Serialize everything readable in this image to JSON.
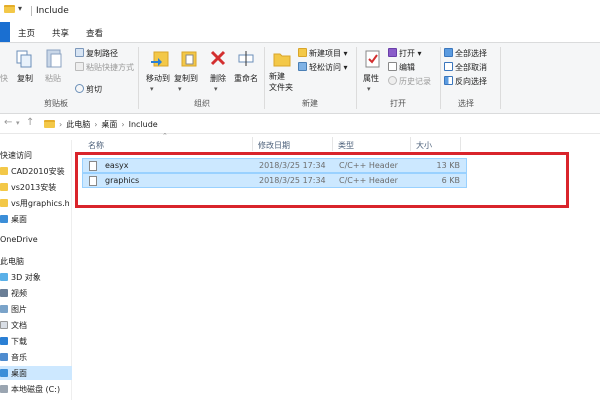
{
  "window": {
    "title": "Include"
  },
  "ribbon_tabs": [
    "主页",
    "共享",
    "查看"
  ],
  "ribbon": {
    "clipboard": {
      "pin_label": "快",
      "copy_label": "复制",
      "paste_label": "粘贴",
      "copy_path_label": "复制路径",
      "paste_shortcut_label": "粘贴快捷方式",
      "cut_label": "剪切",
      "group_label": "剪贴板"
    },
    "organize": {
      "move_to_label": "移动到",
      "copy_to_label": "复制到",
      "delete_label": "删除",
      "rename_label": "重命名",
      "group_label": "组织"
    },
    "new": {
      "new_folder_label": "新建\n文件夹",
      "new_item_label": "新建项目",
      "easy_access_label": "轻松访问",
      "group_label": "新建"
    },
    "open": {
      "properties_label": "属性",
      "open_label": "打开",
      "edit_label": "编辑",
      "history_label": "历史记录",
      "group_label": "打开"
    },
    "select": {
      "select_all_label": "全部选择",
      "select_none_label": "全部取消",
      "invert_label": "反向选择",
      "group_label": "选择"
    }
  },
  "address_bar": {
    "crumbs": [
      "此电脑",
      "桌面",
      "Include"
    ]
  },
  "nav_pane": {
    "items": [
      {
        "label": "快速访问"
      },
      {
        "label": "CAD2010安装"
      },
      {
        "label": "vs2013安装"
      },
      {
        "label": "vs用graphics.h"
      },
      {
        "label": "桌面"
      },
      {
        "label": "OneDrive"
      },
      {
        "label": "此电脑"
      },
      {
        "label": "3D 对象"
      },
      {
        "label": "视频"
      },
      {
        "label": "图片"
      },
      {
        "label": "文档"
      },
      {
        "label": "下载"
      },
      {
        "label": "音乐"
      },
      {
        "label": "桌面"
      },
      {
        "label": "本地磁盘 (C:)"
      }
    ]
  },
  "file_list": {
    "columns": [
      "名称",
      "修改日期",
      "类型",
      "大小"
    ],
    "rows": [
      {
        "name": "easyx",
        "modified": "2018/3/25 17:34",
        "type": "C/C++ Header",
        "size": "13 KB"
      },
      {
        "name": "graphics",
        "modified": "2018/3/25 17:34",
        "type": "C/C++ Header",
        "size": "6 KB"
      }
    ]
  },
  "colors": {
    "accent": "#1a6fd1",
    "selection": "#cce8ff",
    "highlight_box": "#d9242b"
  }
}
